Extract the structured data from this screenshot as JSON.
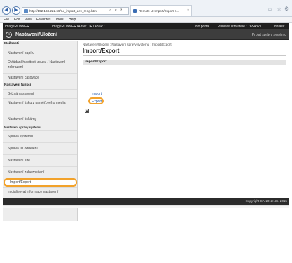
{
  "browser": {
    "address": "http://192.168.222.66/rui_import_dev_reng.html",
    "tab_title": "Remote UI:Import/Export: I...",
    "menu": [
      "File",
      "Edit",
      "View",
      "Favorites",
      "Tools",
      "Help"
    ]
  },
  "page": {
    "device_label": "imageRUNNER",
    "device_model": "imageRUNNER1435P / iR1435P /",
    "portal_link": "No portal",
    "logged_user": "Přihlásit uživatele : 7654321",
    "logout": "Odhlásit",
    "header_title": "Nastavení/Uložení",
    "admin_mode": "Prolat správy systému"
  },
  "sidebar": {
    "group1": "Možnosti",
    "group1_items": [
      "Nastavení papíru",
      "Ovládání hlasitosti zvuku / Nastavení zobrazení",
      "Nastavení časovače"
    ],
    "group2": "Nastavení funkcí",
    "group2_items": [
      "Běžná nastavení",
      "Nastavení tisku z paměťového média",
      "Nastavení tiskárny"
    ],
    "group3": "Nastavení správy systému",
    "group3_items": [
      "Správa systému",
      "Správa ID oddělení",
      "Nastavení sítě",
      "Nastavení zabezpečení",
      "Import/Export",
      "Inicializovat informace nastavení"
    ]
  },
  "content": {
    "breadcrumb": "Nastavení/Uložení : Nastavení správy systému : Import/Export",
    "title": "Import/Export",
    "section_title": "Import/Export",
    "import_link": "Import",
    "export_link": "Export",
    "top_button": "▲"
  },
  "footer": {
    "copyright": "Copyright CANON INC. 2015"
  }
}
